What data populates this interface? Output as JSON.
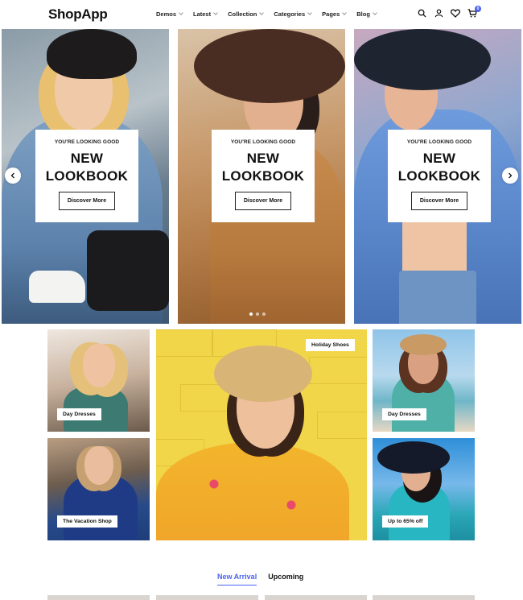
{
  "brand": {
    "logo": "ShopApp",
    "accent": "#4a62f0"
  },
  "nav": {
    "items": [
      {
        "label": "Demos"
      },
      {
        "label": "Latest"
      },
      {
        "label": "Collection"
      },
      {
        "label": "Categories"
      },
      {
        "label": "Pages"
      },
      {
        "label": "Blog"
      }
    ]
  },
  "header_icons": {
    "search": "search-icon",
    "account": "user-icon",
    "wishlist": "heart-icon",
    "cart": "cart-icon",
    "cart_count": "0"
  },
  "slider": {
    "slides": [
      {
        "kicker": "YOU'RE LOOKING GOOD",
        "title_line1": "NEW",
        "title_line2": "LOOKBOOK",
        "button": "Discover More"
      },
      {
        "kicker": "YOU'RE LOOKING GOOD",
        "title_line1": "NEW",
        "title_line2": "LOOKBOOK",
        "button": "Discover More"
      },
      {
        "kicker": "YOU'RE LOOKING GOOD",
        "title_line1": "NEW",
        "title_line2": "LOOKBOOK",
        "button": "Discover More"
      }
    ],
    "prev_icon": "chevron-left-icon",
    "next_icon": "chevron-right-icon"
  },
  "categories": {
    "tiles": [
      {
        "label": "Day Dresses"
      },
      {
        "label": "The Vacation Shop"
      },
      {
        "label": "Holiday Shoes"
      },
      {
        "label": "Day Dresses"
      },
      {
        "label": "Up to 65% off"
      }
    ]
  },
  "product_tabs": [
    {
      "label": "New Arrival",
      "active": true
    },
    {
      "label": "Upcoming",
      "active": false
    }
  ]
}
